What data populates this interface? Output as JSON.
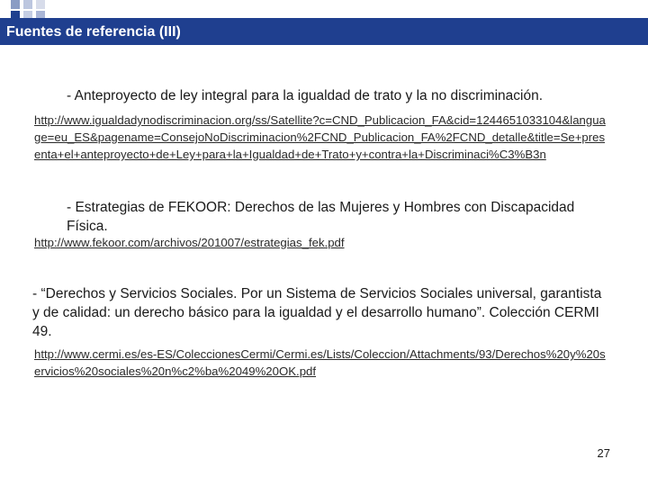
{
  "slide": {
    "title": "Fuentes de referencia (III)",
    "page_number": "27",
    "references": [
      {
        "title": "- Anteproyecto de ley integral para la igualdad de trato y la no discriminación.",
        "url": "http://www.igualdadynodiscriminacion.org/ss/Satellite?c=CND_Publicacion_FA&cid=1244651033104&language=eu_ES&pagename=ConsejoNoDiscriminacion%2FCND_Publicacion_FA%2FCND_detalle&title=Se+presenta+el+anteproyecto+de+Ley+para+la+Igualdad+de+Trato+y+contra+la+Discriminaci%C3%B3n"
      },
      {
        "title": "- Estrategias de FEKOOR: Derechos de las Mujeres y Hombres con Discapacidad Física.",
        "url": "http://www.fekoor.com/archivos/201007/estrategias_fek.pdf"
      },
      {
        "title": "- “Derechos y Servicios Sociales. Por un Sistema de Servicios Sociales universal, garantista y de calidad: un derecho básico para la igualdad y el desarrollo humano”.  Colección CERMI 49.",
        "url": "http://www.cermi.es/es-ES/ColeccionesCermi/Cermi.es/Lists/Coleccion/Attachments/93/Derechos%20y%20servicios%20sociales%20n%c2%ba%2049%20OK.pdf"
      }
    ]
  }
}
